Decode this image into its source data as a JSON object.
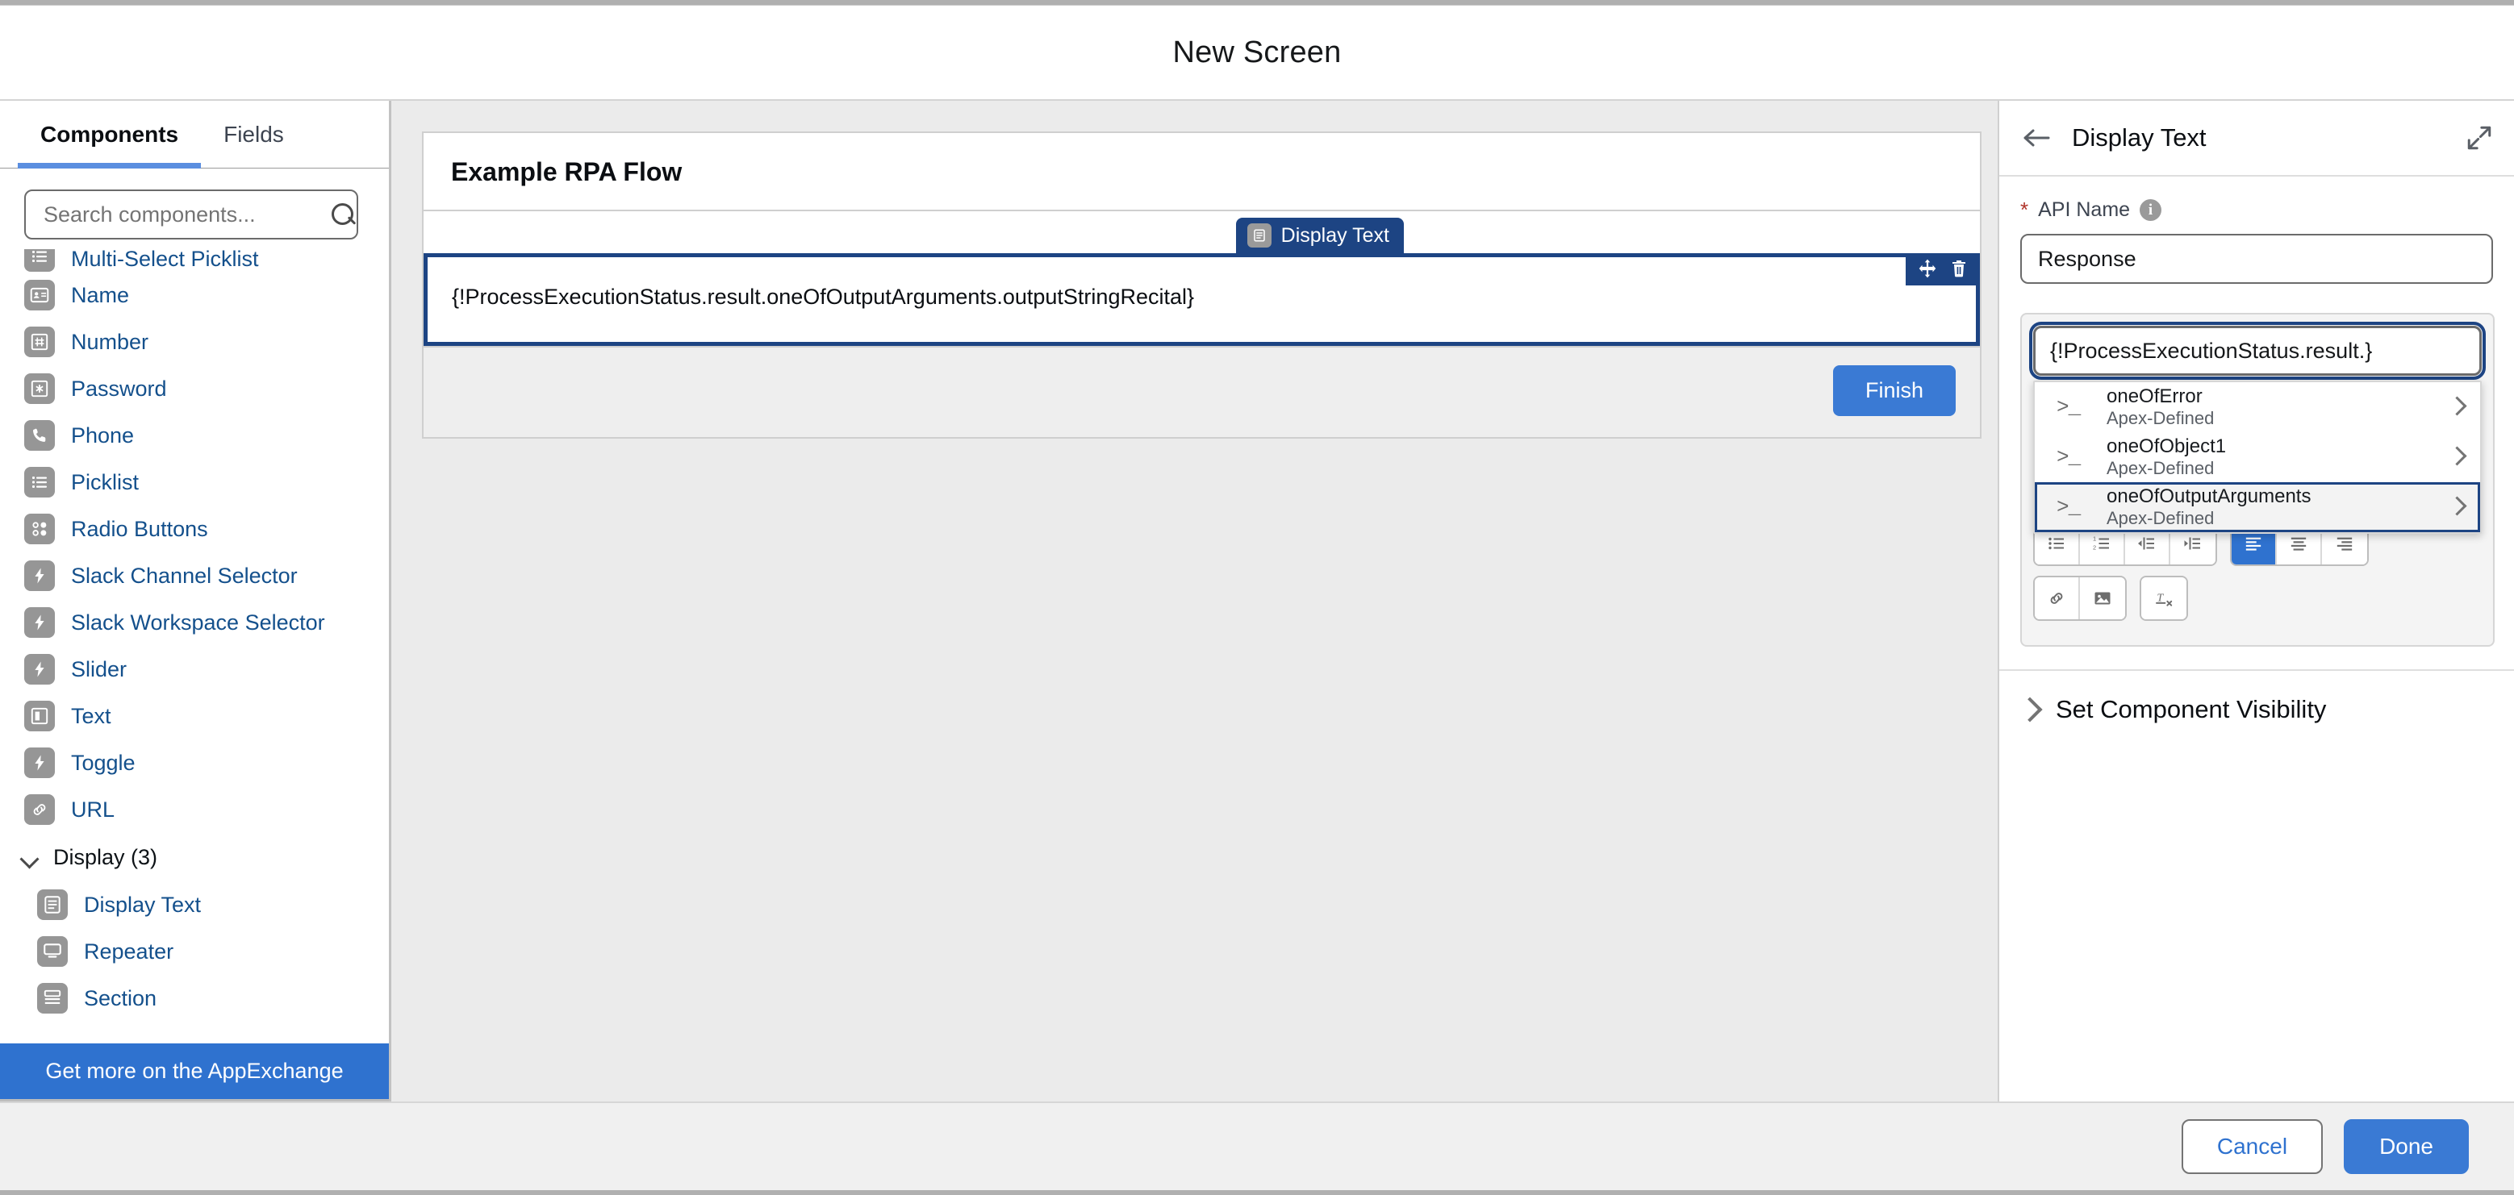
{
  "window": {
    "title": "New Screen"
  },
  "left_panel": {
    "tabs": [
      {
        "label": "Components",
        "active": true
      },
      {
        "label": "Fields",
        "active": false
      }
    ],
    "search": {
      "placeholder": "Search components...",
      "value": "",
      "icon": "search-icon"
    },
    "components": [
      {
        "label": "Multi-Select Picklist",
        "icon": "picklist-icon",
        "clipped": true
      },
      {
        "label": "Name",
        "icon": "name-card-icon"
      },
      {
        "label": "Number",
        "icon": "number-hash-icon"
      },
      {
        "label": "Password",
        "icon": "password-asterisk-icon"
      },
      {
        "label": "Phone",
        "icon": "phone-icon"
      },
      {
        "label": "Picklist",
        "icon": "picklist-icon"
      },
      {
        "label": "Radio Buttons",
        "icon": "radio-buttons-icon"
      },
      {
        "label": "Slack Channel Selector",
        "icon": "lightning-bolt-icon"
      },
      {
        "label": "Slack Workspace Selector",
        "icon": "lightning-bolt-icon"
      },
      {
        "label": "Slider",
        "icon": "lightning-bolt-icon"
      },
      {
        "label": "Text",
        "icon": "text-box-icon"
      },
      {
        "label": "Toggle",
        "icon": "lightning-bolt-icon"
      },
      {
        "label": "URL",
        "icon": "link-icon"
      }
    ],
    "group": {
      "label": "Display (3)",
      "expanded": true,
      "icon": "chevron-down-icon"
    },
    "group_items": [
      {
        "label": "Display Text",
        "icon": "display-text-icon"
      },
      {
        "label": "Repeater",
        "icon": "repeater-icon"
      },
      {
        "label": "Section",
        "icon": "section-icon"
      }
    ],
    "appexchange_label": "Get more on the AppExchange"
  },
  "canvas": {
    "flow_name": "Example RPA Flow",
    "selected_tab_label": "Display Text",
    "selected_tab_icon": "display-text-icon",
    "component_text": "{!ProcessExecutionStatus.result.oneOfOutputArguments.outputStringRecital}",
    "actions": [
      {
        "name": "drag-handle-icon"
      },
      {
        "name": "delete-icon"
      }
    ],
    "finish_label": "Finish"
  },
  "right_panel": {
    "back_icon": "arrow-left-icon",
    "title": "Display Text",
    "expand_icon": "expand-icon",
    "api_name": {
      "label": "API Name",
      "required_marker": "*",
      "info_icon": "info-icon",
      "value": "Response"
    },
    "rich_text": {
      "input_value": "{!ProcessExecutionStatus.result.}",
      "dropdown": [
        {
          "name": "oneOfError",
          "type": "Apex-Defined",
          "icon": "console-prompt-icon",
          "selected": false
        },
        {
          "name": "oneOfObject1",
          "type": "Apex-Defined",
          "icon": "console-prompt-icon",
          "selected": false
        },
        {
          "name": "oneOfOutputArguments",
          "type": "Apex-Defined",
          "icon": "console-prompt-icon",
          "selected": true
        }
      ],
      "toolbar": {
        "color_swatch": "#000000",
        "buttons": [
          {
            "name": "text-color-picker",
            "glyph": "color",
            "active": false
          },
          {
            "name": "bold-button",
            "glyph": "B",
            "active": false
          },
          {
            "name": "italic-button",
            "glyph": "I",
            "active": false
          },
          {
            "name": "underline-button",
            "glyph": "U",
            "active": false
          },
          {
            "name": "bulleted-list-button",
            "glyph": "ul",
            "active": false
          },
          {
            "name": "numbered-list-button",
            "glyph": "ol",
            "active": false
          },
          {
            "name": "indent-button",
            "glyph": "indent",
            "active": false
          },
          {
            "name": "outdent-button",
            "glyph": "outdent",
            "active": false
          },
          {
            "name": "align-left-button",
            "glyph": "align-left",
            "active": true
          },
          {
            "name": "align-center-button",
            "glyph": "align-center",
            "active": false
          },
          {
            "name": "align-right-button",
            "glyph": "align-right",
            "active": false
          },
          {
            "name": "insert-link-button",
            "glyph": "link",
            "active": false
          },
          {
            "name": "insert-image-button",
            "glyph": "image",
            "active": false
          },
          {
            "name": "remove-formatting-button",
            "glyph": "clear-format",
            "active": false
          }
        ]
      }
    },
    "visibility": {
      "label": "Set Component Visibility",
      "icon": "chevron-right-icon",
      "expanded": false
    }
  },
  "footer": {
    "cancel_label": "Cancel",
    "done_label": "Done"
  },
  "colors": {
    "accent_blue": "#2f72cf",
    "selected_navy": "#1d4483",
    "link_blue": "#14508c",
    "required_red": "#b0342a"
  }
}
